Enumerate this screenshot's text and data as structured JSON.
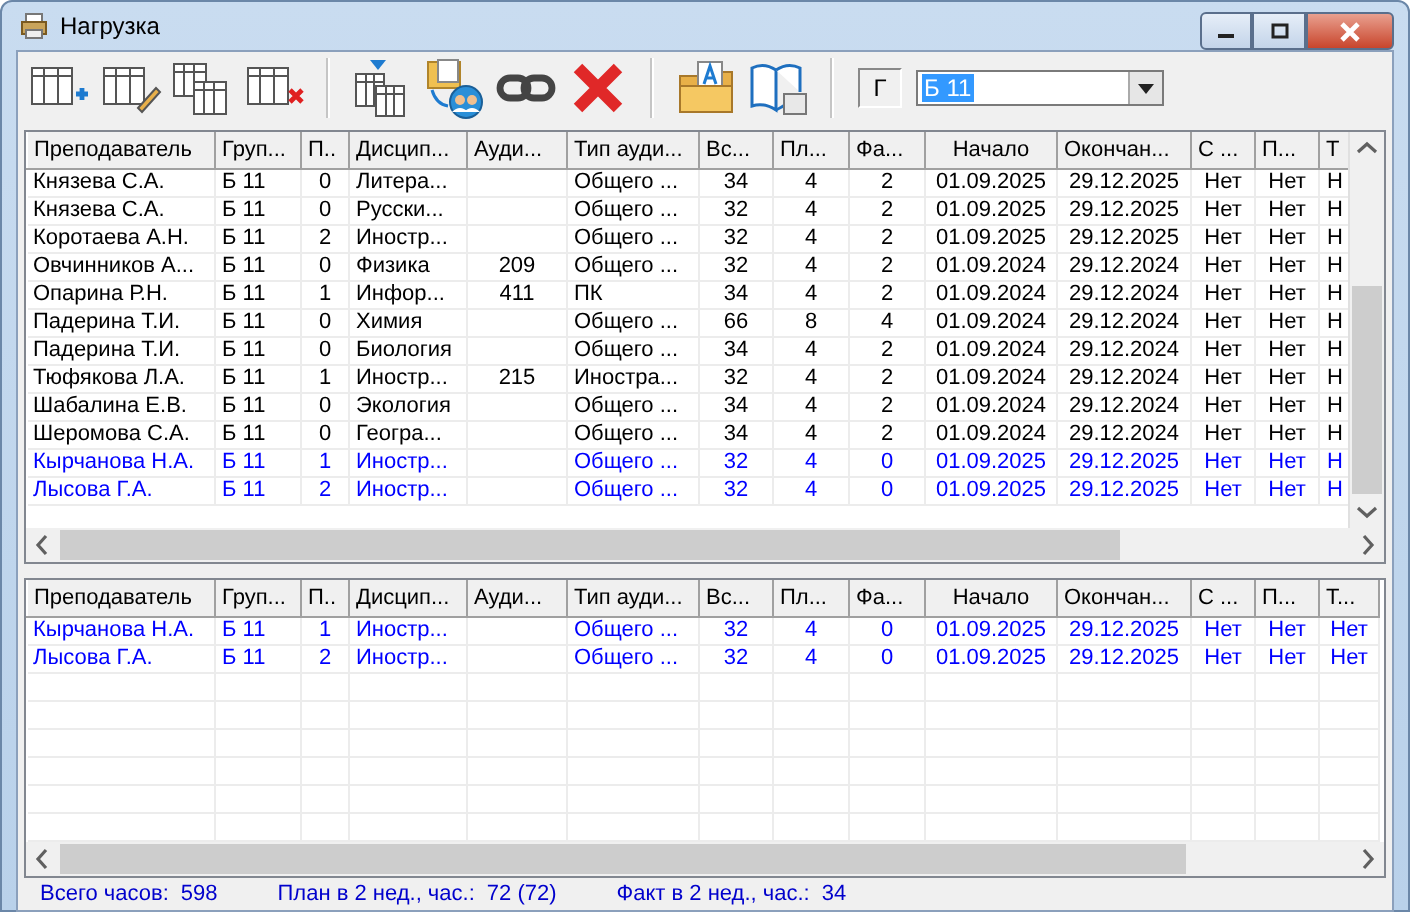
{
  "window": {
    "title": "Нагрузка"
  },
  "filter": {
    "label": "Г",
    "value": "Б 11"
  },
  "upper_table": {
    "columns": [
      "Преподаватель",
      "Груп...",
      "П..",
      "Дисцип...",
      "Ауди...",
      "Тип ауди...",
      "Вс...",
      "Пл...",
      "Фа...",
      "Начало",
      "Окончан...",
      "С ...",
      "П...",
      "Т"
    ],
    "rows": [
      {
        "color": "#000000",
        "cells": [
          "Князева С.А.",
          "Б 11",
          "0",
          "Литера...",
          null,
          "Общего ...",
          "34",
          "4",
          "2",
          "01.09.2025",
          "29.12.2025",
          "Нет",
          "Нет",
          "Н"
        ]
      },
      {
        "color": "#000000",
        "cells": [
          "Князева С.А.",
          "Б 11",
          "0",
          "Русски...",
          null,
          "Общего ...",
          "32",
          "4",
          "2",
          "01.09.2025",
          "29.12.2025",
          "Нет",
          "Нет",
          "Н"
        ]
      },
      {
        "color": "#000000",
        "cells": [
          "Коротаева А.Н.",
          "Б 11",
          "2",
          "Иностр...",
          null,
          "Общего ...",
          "32",
          "4",
          "2",
          "01.09.2025",
          "29.12.2025",
          "Нет",
          "Нет",
          "Н"
        ]
      },
      {
        "color": "#000000",
        "cells": [
          "Овчинников А...",
          "Б 11",
          "0",
          "Физика",
          "209",
          "Общего ...",
          "32",
          "4",
          "2",
          "01.09.2024",
          "29.12.2024",
          "Нет",
          "Нет",
          "Н"
        ]
      },
      {
        "color": "#000000",
        "cells": [
          "Опарина Р.Н.",
          "Б 11",
          "1",
          "Инфор...",
          "411",
          "ПК",
          "34",
          "4",
          "2",
          "01.09.2024",
          "29.12.2024",
          "Нет",
          "Нет",
          "Н"
        ]
      },
      {
        "color": "#000000",
        "cells": [
          "Падерина Т.И.",
          "Б 11",
          "0",
          "Химия",
          null,
          "Общего ...",
          "66",
          "8",
          "4",
          "01.09.2024",
          "29.12.2024",
          "Нет",
          "Нет",
          "Н"
        ]
      },
      {
        "color": "#000000",
        "cells": [
          "Падерина Т.И.",
          "Б 11",
          "0",
          "Биология",
          null,
          "Общего ...",
          "34",
          "4",
          "2",
          "01.09.2024",
          "29.12.2024",
          "Нет",
          "Нет",
          "Н"
        ]
      },
      {
        "color": "#000000",
        "cells": [
          "Тюфякова Л.А.",
          "Б 11",
          "1",
          "Иностр...",
          "215",
          "Иностра...",
          "32",
          "4",
          "2",
          "01.09.2024",
          "29.12.2024",
          "Нет",
          "Нет",
          "Н"
        ]
      },
      {
        "color": "#000000",
        "cells": [
          "Шабалина Е.В.",
          "Б 11",
          "0",
          "Экология",
          null,
          "Общего ...",
          "34",
          "4",
          "2",
          "01.09.2024",
          "29.12.2024",
          "Нет",
          "Нет",
          "Н"
        ]
      },
      {
        "color": "#000000",
        "cells": [
          "Шеромова С.А.",
          "Б 11",
          "0",
          "Геогра...",
          null,
          "Общего ...",
          "34",
          "4",
          "2",
          "01.09.2024",
          "29.12.2024",
          "Нет",
          "Нет",
          "Н"
        ]
      },
      {
        "color": "#0000ff",
        "cells": [
          "Кырчанова Н.А.",
          "Б 11",
          "1",
          "Иностр...",
          null,
          "Общего ...",
          "32",
          "4",
          "0",
          "01.09.2025",
          "29.12.2025",
          "Нет",
          "Нет",
          "Н"
        ]
      },
      {
        "color": "#0000ff",
        "cells": [
          "Лысова Г.А.",
          "Б 11",
          "2",
          "Иностр...",
          null,
          "Общего ...",
          "32",
          "4",
          "0",
          "01.09.2025",
          "29.12.2025",
          "Нет",
          "Нет",
          "Н"
        ]
      }
    ]
  },
  "lower_table": {
    "columns": [
      "Преподаватель",
      "Груп...",
      "П..",
      "Дисцип...",
      "Ауди...",
      "Тип ауди...",
      "Вс...",
      "Пл...",
      "Фа...",
      "Начало",
      "Окончан...",
      "С ...",
      "П...",
      "Т..."
    ],
    "rows": [
      {
        "color": "#0000ff",
        "cells": [
          "Кырчанова Н.А.",
          "Б 11",
          "1",
          "Иностр...",
          null,
          "Общего ...",
          "32",
          "4",
          "0",
          "01.09.2025",
          "29.12.2025",
          "Нет",
          "Нет",
          "Нет"
        ]
      },
      {
        "color": "#0000ff",
        "cells": [
          "Лысова Г.А.",
          "Б 11",
          "2",
          "Иностр...",
          null,
          "Общего ...",
          "32",
          "4",
          "0",
          "01.09.2025",
          "29.12.2025",
          "Нет",
          "Нет",
          "Нет"
        ]
      }
    ]
  },
  "status_bar": [
    {
      "label": "Всего часов:",
      "value": "598"
    },
    {
      "label": "План в 2 нед., час.:",
      "value": "72 (72)"
    },
    {
      "label": "Факт в 2 нед., час.:",
      "value": "34"
    }
  ]
}
